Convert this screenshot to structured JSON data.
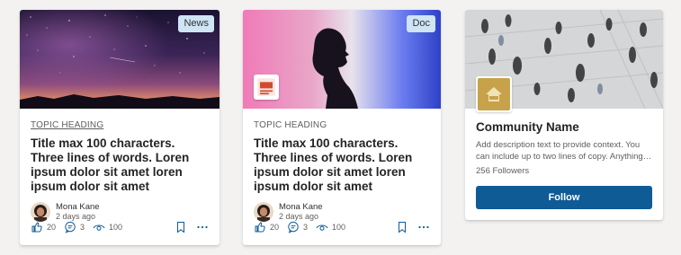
{
  "cards": [
    {
      "tag": "News",
      "topic": "TOPIC HEADING",
      "title": "Title max 100 characters. Three lines of words. Loren ipsum dolor sit amet loren ipsum dolor sit amet",
      "author": "Mona Kane",
      "time": "2 days ago",
      "likes": "20",
      "comments": "3",
      "views": "100"
    },
    {
      "tag": "Doc",
      "topic": "TOPIC HEADING",
      "title": "Title max 100 characters. Three lines of words. Loren ipsum dolor sit amet loren ipsum dolor sit amet",
      "author": "Mona Kane",
      "time": "2 days ago",
      "likes": "20",
      "comments": "3",
      "views": "100"
    }
  ],
  "community": {
    "name": "Community Name",
    "description": "Add description text to provide context. You can include up to two lines of copy. Anything added…",
    "followers": "256 Followers",
    "follow_label": "Follow"
  },
  "colors": {
    "accent": "#0f5b96",
    "tag_bg": "#cfe4f5"
  },
  "icons": [
    "like-icon",
    "comment-icon",
    "view-icon",
    "bookmark-icon",
    "more-icon",
    "document-icon",
    "community-logo-icon"
  ]
}
